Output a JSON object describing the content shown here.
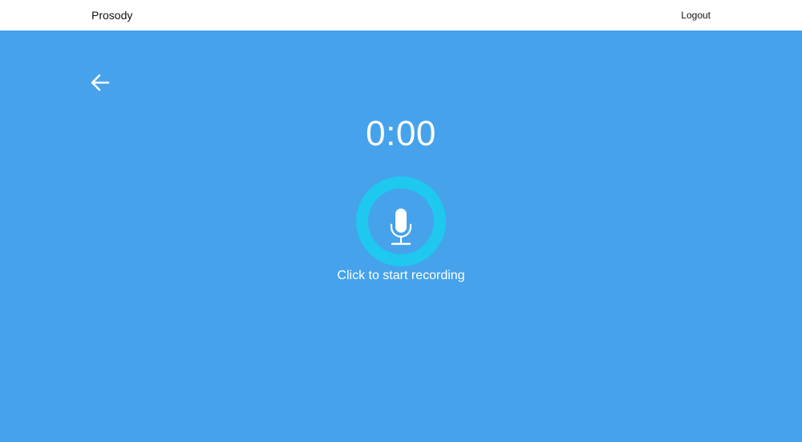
{
  "navbar": {
    "brand": "Prosody",
    "logout_label": "Logout"
  },
  "recorder": {
    "timer": "0:00",
    "caption": "Click to start recording",
    "back_icon": "arrow-left-icon",
    "mic_icon": "microphone-icon"
  },
  "colors": {
    "background": "#46a2eb",
    "mic_ring": "#1fc8ef",
    "navbar": "#ffffff"
  }
}
